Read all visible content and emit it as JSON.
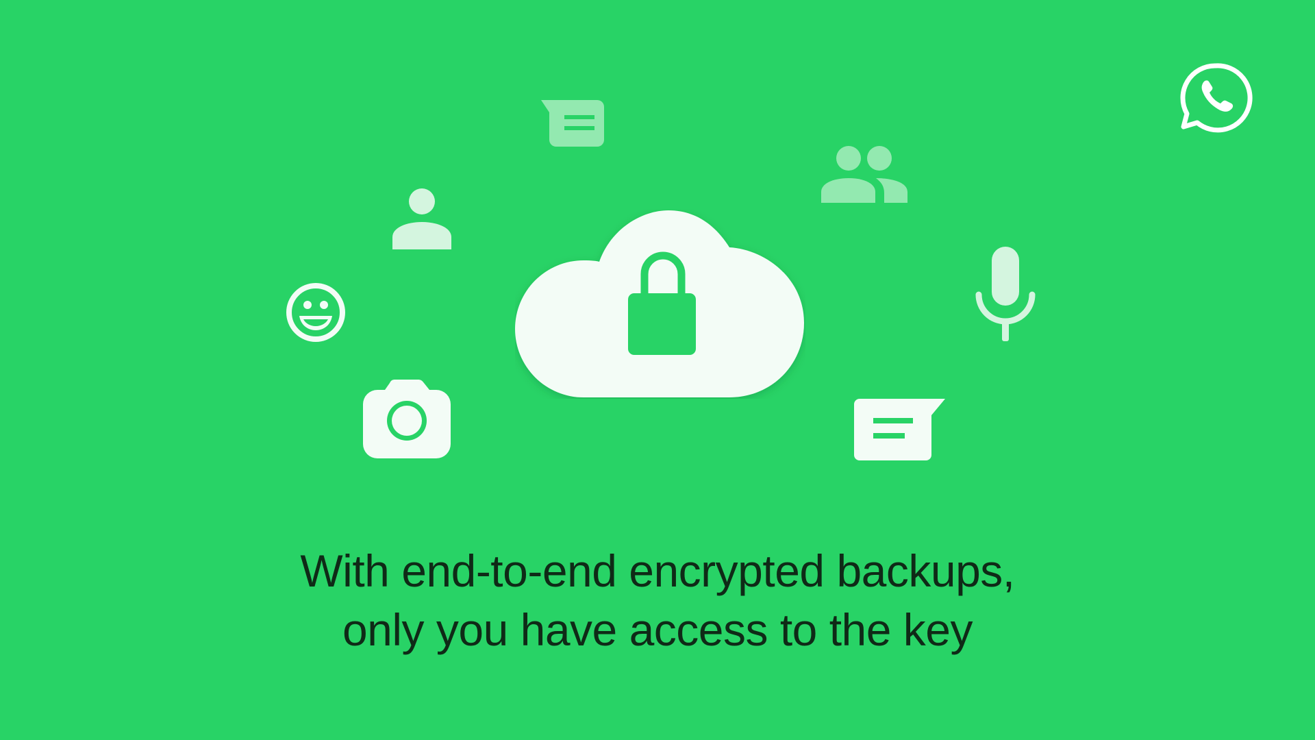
{
  "background_color": "#28D366",
  "brand": {
    "logo_icon": "whatsapp-logo-icon"
  },
  "illustration": {
    "center_icon": "cloud-lock-icon",
    "surrounding_icons": [
      "message-bubble-icon",
      "group-people-icon",
      "person-icon",
      "microphone-icon",
      "smiley-face-icon",
      "camera-icon",
      "message-bubble-icon"
    ]
  },
  "headline": {
    "line1": "With end-to-end encrypted backups,",
    "line2": "only you have access to the key"
  },
  "colors": {
    "icon_solid": "#F3FCF6",
    "icon_soft": "#D4F5DF",
    "icon_faded": "#93E9B0",
    "text": "#0F2A17"
  }
}
